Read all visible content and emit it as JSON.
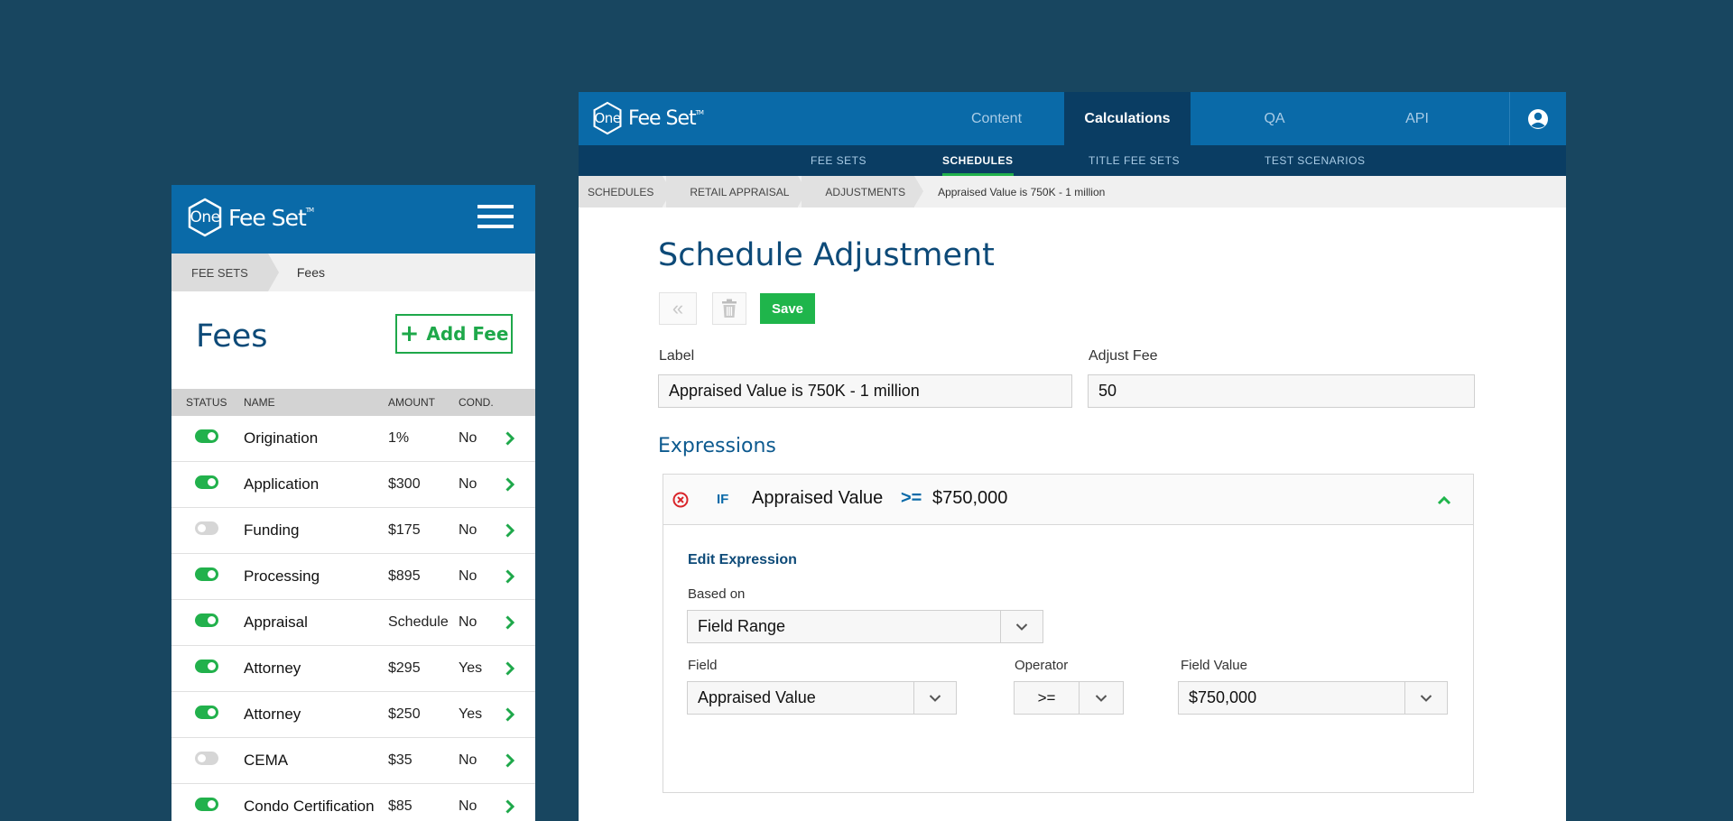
{
  "brand": {
    "logo_mark": "One",
    "logo_word": "Fee Set",
    "logo_tm": "TM"
  },
  "mobile": {
    "breadcrumb": {
      "root": "FEE SETS",
      "current": "Fees"
    },
    "title": "Fees",
    "add_button_label": "Add Fee",
    "columns": {
      "status": "STATUS",
      "name": "NAME",
      "amount": "AMOUNT",
      "cond": "COND."
    },
    "rows": [
      {
        "enabled": true,
        "name": "Origination",
        "amount": "1%",
        "cond": "No"
      },
      {
        "enabled": true,
        "name": "Application",
        "amount": "$300",
        "cond": "No"
      },
      {
        "enabled": false,
        "name": "Funding",
        "amount": "$175",
        "cond": "No"
      },
      {
        "enabled": true,
        "name": "Processing",
        "amount": "$895",
        "cond": "No"
      },
      {
        "enabled": true,
        "name": "Appraisal",
        "amount": "Schedule",
        "cond": "No"
      },
      {
        "enabled": true,
        "name": "Attorney",
        "amount": "$295",
        "cond": "Yes"
      },
      {
        "enabled": true,
        "name": "Attorney",
        "amount": "$250",
        "cond": "Yes"
      },
      {
        "enabled": false,
        "name": "CEMA",
        "amount": "$35",
        "cond": "No"
      },
      {
        "enabled": true,
        "name": "Condo Certification",
        "amount": "$85",
        "cond": "No"
      }
    ]
  },
  "desktop": {
    "nav": [
      "Content",
      "Calculations",
      "QA",
      "API"
    ],
    "nav_active": "Calculations",
    "subnav": [
      "FEE SETS",
      "SCHEDULES",
      "TITLE FEE SETS",
      "TEST SCENARIOS"
    ],
    "subnav_active": "SCHEDULES",
    "breadcrumbs": [
      "SCHEDULES",
      "RETAIL APPRAISAL",
      "ADJUSTMENTS"
    ],
    "breadcrumb_current": "Appraised Value is 750K - 1 million",
    "title": "Schedule Adjustment",
    "back_glyph": "«",
    "save_label": "Save",
    "label_field": {
      "label": "Label",
      "value": "Appraised Value is 750K - 1 million"
    },
    "adjust_fee": {
      "label": "Adjust Fee",
      "value": "50"
    },
    "expressions_heading": "Expressions",
    "expression": {
      "keyword": "IF",
      "field": "Appraised Value",
      "operator": ">=",
      "value": "$750,000",
      "edit_heading": "Edit Expression",
      "based_on": {
        "label": "Based on",
        "value": "Field Range"
      },
      "field_select": {
        "label": "Field",
        "value": "Appraised Value"
      },
      "operator_select": {
        "label": "Operator",
        "value": ">="
      },
      "field_value": {
        "label": "Field Value",
        "value": "$750,000"
      }
    }
  },
  "colors": {
    "background": "#184660",
    "brand_blue": "#0a6aa8",
    "nav_dark": "#0a3d63",
    "accent_green": "#1fb54b"
  },
  "icons": [
    "menu-icon",
    "plus-icon",
    "toggle-icon",
    "chevron-right-icon",
    "user-icon",
    "rewind-icon",
    "trash-icon",
    "remove-circle-icon",
    "chevron-up-icon",
    "chevron-down-icon"
  ]
}
